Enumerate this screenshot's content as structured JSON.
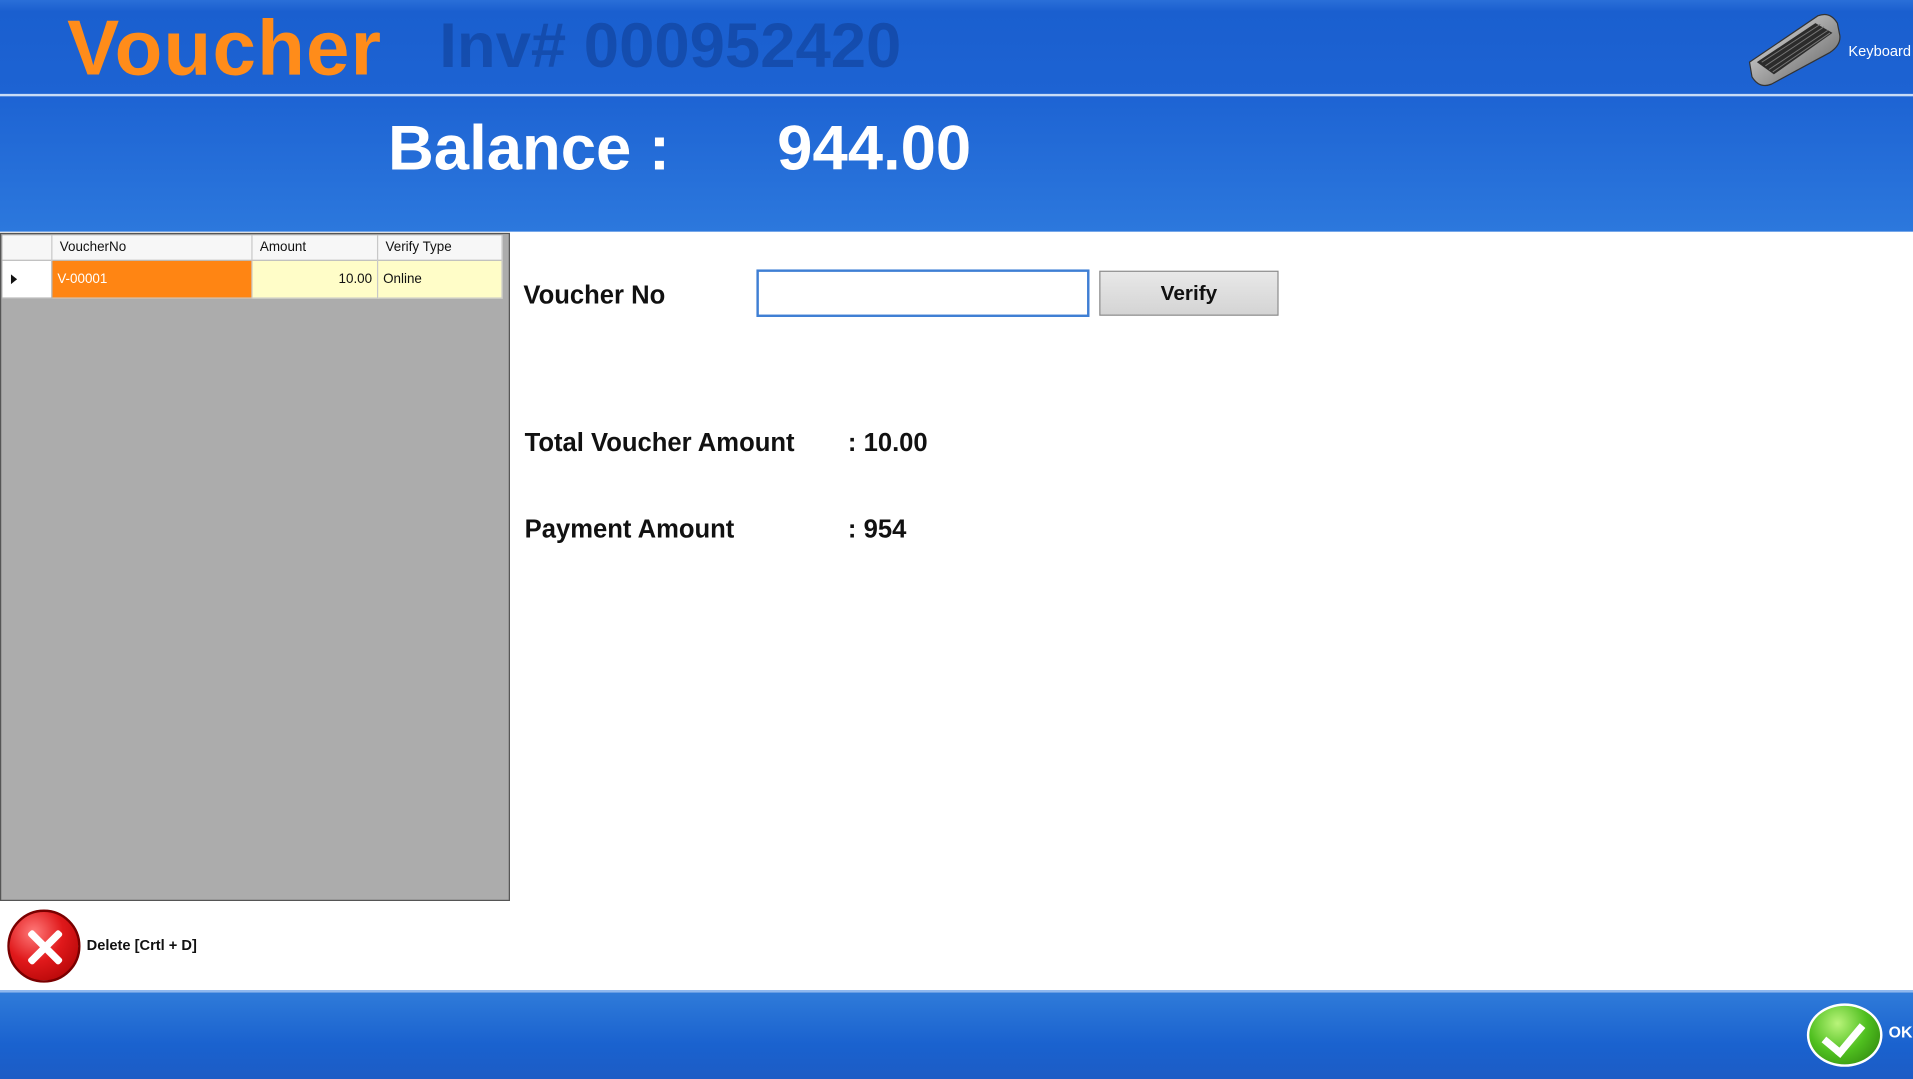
{
  "header": {
    "title": "Voucher",
    "ghost_text": "Inv# 000952420",
    "balance_label": "Balance :",
    "balance_value": "944.00"
  },
  "keyboard": {
    "label": "Keyboard",
    "icon": "keyboard-icon"
  },
  "grid": {
    "columns": [
      "VoucherNo",
      "Amount",
      "Verify Type"
    ],
    "rows": [
      {
        "voucher_no": "V-00001",
        "amount": "10.00",
        "verify_type": "Online"
      }
    ]
  },
  "form": {
    "voucher_no_label": "Voucher No",
    "voucher_no_value": "",
    "verify_label": "Verify",
    "total_voucher_amount_label": "Total Voucher Amount",
    "total_voucher_amount_value": ": 10.00",
    "payment_amount_label": "Payment Amount",
    "payment_amount_value": ": 954"
  },
  "actions": {
    "delete_label": "Delete [Crtl + D]",
    "ok_label": "OK"
  },
  "colors": {
    "header_blue": "#1d63d3",
    "title_orange": "#ff8c1a",
    "selected_cell": "#ff8513",
    "row_highlight": "#fffdc8"
  }
}
